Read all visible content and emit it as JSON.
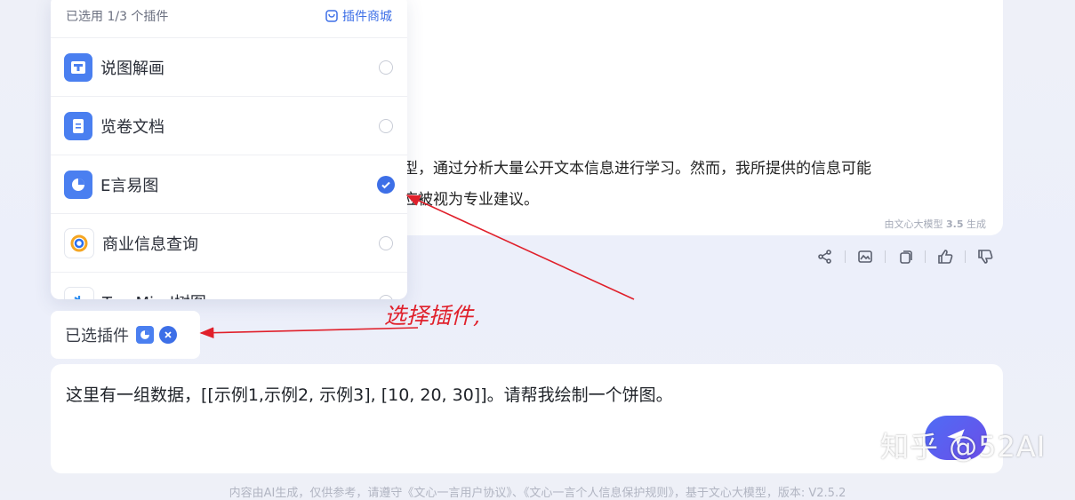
{
  "plugin_panel": {
    "header": "已选用 1/3 个插件",
    "store_label": "插件商城",
    "plugins": [
      {
        "name": "说图解画",
        "checked": false,
        "icon": "image-text-icon",
        "color": "#4a7ff0"
      },
      {
        "name": "览卷文档",
        "checked": false,
        "icon": "document-icon",
        "color": "#4a7ff0"
      },
      {
        "name": "E言易图",
        "checked": true,
        "icon": "pie-chart-icon",
        "color": "#4a7ff0"
      },
      {
        "name": "商业信息查询",
        "checked": false,
        "icon": "business-search-icon",
        "color": "#2a6ff0"
      },
      {
        "name": "TreeMind树图",
        "checked": false,
        "icon": "tree-icon",
        "color": "#2a8cf0"
      }
    ]
  },
  "answer": {
    "line1": "型，通过分析大量公开文本信息进行学习。然而，我所提供的信息可能",
    "line2": "应被视为专业建议。",
    "gen_prefix": "由文心大模型 ",
    "gen_version": "3.5",
    "gen_suffix": " 生成"
  },
  "selected": {
    "label": "已选插件"
  },
  "input": {
    "text": "这里有一组数据，[[示例1,示例2, 示例3], [10, 20, 30]]。请帮我绘制一个饼图。"
  },
  "annotation": "选择插件,",
  "watermark": "知乎 @52AI",
  "footer": "内容由AI生成，仅供参考，请遵守《文心一言用户协议》、《文心一言个人信息保护规则》，基于文心大模型，版本: V2.5.2"
}
